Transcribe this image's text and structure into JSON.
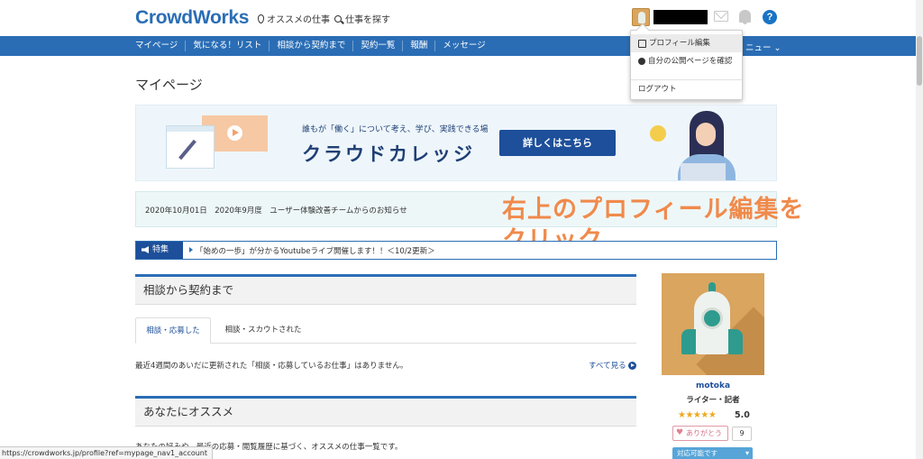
{
  "header": {
    "logo": "CrowdWorks",
    "nav_recommended": "オススメの仕事",
    "nav_search": "仕事を探す",
    "help": "?"
  },
  "bluenav": {
    "items": [
      "マイページ",
      "気になる！リスト",
      "相談から契約まで",
      "契約一覧",
      "報酬",
      "メッセージ"
    ],
    "more": "ニュー ⌄"
  },
  "dropdown": {
    "items": [
      "プロフィール編集",
      "自分の公開ページを確認",
      "ログアウト"
    ]
  },
  "page": {
    "title": "マイページ"
  },
  "banner": {
    "tagline": "誰もが「働く」について考え、学び、実践できる場",
    "name": "クラウドカレッジ",
    "button": "詳しくはこちら"
  },
  "notice": {
    "text": "2020年10月01日　2020年9月度　ユーザー体験改善チームからのお知らせ"
  },
  "overlay": {
    "line1": "右上のプロフィール編集を",
    "line2": "クリック"
  },
  "feature": {
    "tag": "特集",
    "text": "「始めの一歩」が分かるYoutubeライブ開催します！！＜10/2更新＞"
  },
  "section1": {
    "title": "相談から契約まで",
    "tabs": [
      "相談・応募した",
      "相談・スカウトされた"
    ],
    "info": "最近4週間のあいだに更新された「相談・応募しているお仕事」はありません。",
    "see_all": "すべて見る"
  },
  "section2": {
    "title": "あなたにオススメ",
    "desc": "あなたの好みや、最近の応募・閲覧履歴に基づく、オススメの仕事一覧です。"
  },
  "profile": {
    "name": "motoka",
    "role": "ライター・記者",
    "stars": "★★★★★",
    "score": "5.0",
    "thanks_label": "ありがとう",
    "thanks_count": "9",
    "availability": "対応可能です"
  },
  "statusbar": {
    "url": "https://crowdworks.jp/profile?ref=mypage_nav1_account"
  },
  "colors": {
    "brand": "#2a6db5",
    "accent_overlay": "#f08a4b",
    "dark_blue": "#1d4f9a"
  }
}
